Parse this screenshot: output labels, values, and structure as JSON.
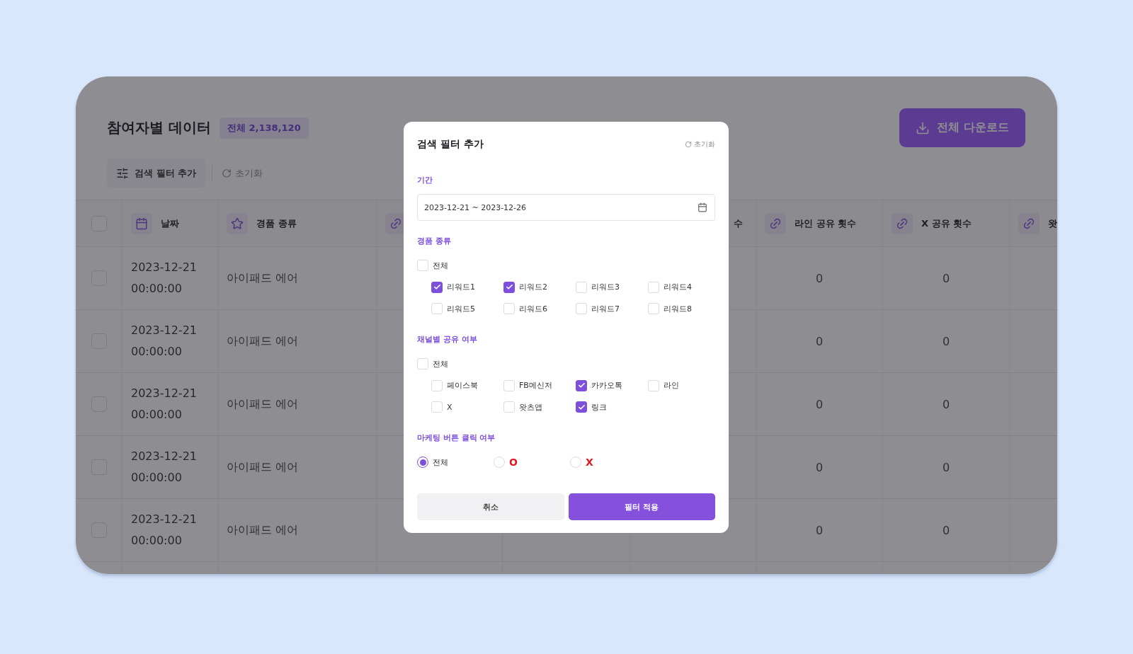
{
  "page": {
    "title": "참여자별 데이터",
    "total_badge": "전체 2,138,120",
    "download_button": "전체 다운로드",
    "filter_button": "검색 필터 추가",
    "reset_button": "초기화"
  },
  "table": {
    "select_all_checked": false,
    "columns": [
      {
        "kind": "date",
        "label": "날짜"
      },
      {
        "kind": "prize",
        "label": "경품 종류"
      },
      {
        "kind": "share_icon_only"
      },
      {
        "kind": "covered"
      },
      {
        "kind": "label_end",
        "label": "수"
      },
      {
        "kind": "share",
        "label": "라인 공유 횟수"
      },
      {
        "kind": "share",
        "label": "X 공유 횟수"
      },
      {
        "kind": "share",
        "label": "왓"
      }
    ],
    "rows": [
      {
        "checked": false,
        "date": "2023-12-21",
        "time": "00:00:00",
        "prize": "아이패드 에어",
        "line_shares": "0",
        "x_shares": "0"
      },
      {
        "checked": false,
        "date": "2023-12-21",
        "time": "00:00:00",
        "prize": "아이패드 에어",
        "line_shares": "0",
        "x_shares": "0"
      },
      {
        "checked": false,
        "date": "2023-12-21",
        "time": "00:00:00",
        "prize": "아이패드 에어",
        "line_shares": "0",
        "x_shares": "0"
      },
      {
        "checked": false,
        "date": "2023-12-21",
        "time": "00:00:00",
        "prize": "아이패드 에어",
        "line_shares": "0",
        "x_shares": "0"
      },
      {
        "checked": false,
        "date": "2023-12-21",
        "time": "00:00:00",
        "prize": "아이패드 에어",
        "line_shares": "0",
        "x_shares": "0"
      }
    ]
  },
  "filter_modal": {
    "title": "검색 필터 추가",
    "reset": "초기화",
    "sections": [
      {
        "kind": "date",
        "label": "기간",
        "value": "2023-12-21 ~ 2023-12-26"
      },
      {
        "kind": "checkbox",
        "label": "경품 종류",
        "all": {
          "label": "전체",
          "checked": false
        },
        "options": [
          {
            "label": "리워드1",
            "checked": true
          },
          {
            "label": "리워드2",
            "checked": true
          },
          {
            "label": "리워드3",
            "checked": false
          },
          {
            "label": "리워드4",
            "checked": false
          },
          {
            "label": "리워드5",
            "checked": false
          },
          {
            "label": "리워드6",
            "checked": false
          },
          {
            "label": "리워드7",
            "checked": false
          },
          {
            "label": "리워드8",
            "checked": false
          }
        ]
      },
      {
        "kind": "checkbox",
        "label": "채널별 공유 여부",
        "all": {
          "label": "전체",
          "checked": false
        },
        "options": [
          {
            "label": "페이스북",
            "checked": false
          },
          {
            "label": "FB메신저",
            "checked": false
          },
          {
            "label": "카카오톡",
            "checked": true
          },
          {
            "label": "라인",
            "checked": false
          },
          {
            "label": "X",
            "checked": false
          },
          {
            "label": "왓츠앱",
            "checked": false
          },
          {
            "label": "링크",
            "checked": true
          }
        ]
      },
      {
        "kind": "radio",
        "label": "마케팅 버튼 클릭 여부",
        "options": [
          {
            "label": "전체",
            "kind": "text",
            "selected": true
          },
          {
            "label": "O",
            "kind": "mark",
            "selected": false
          },
          {
            "label": "X",
            "kind": "mark",
            "selected": false
          }
        ]
      }
    ],
    "buttons": [
      {
        "label": "취소",
        "kind": "secondary"
      },
      {
        "label": "필터 적용",
        "kind": "primary"
      }
    ]
  }
}
